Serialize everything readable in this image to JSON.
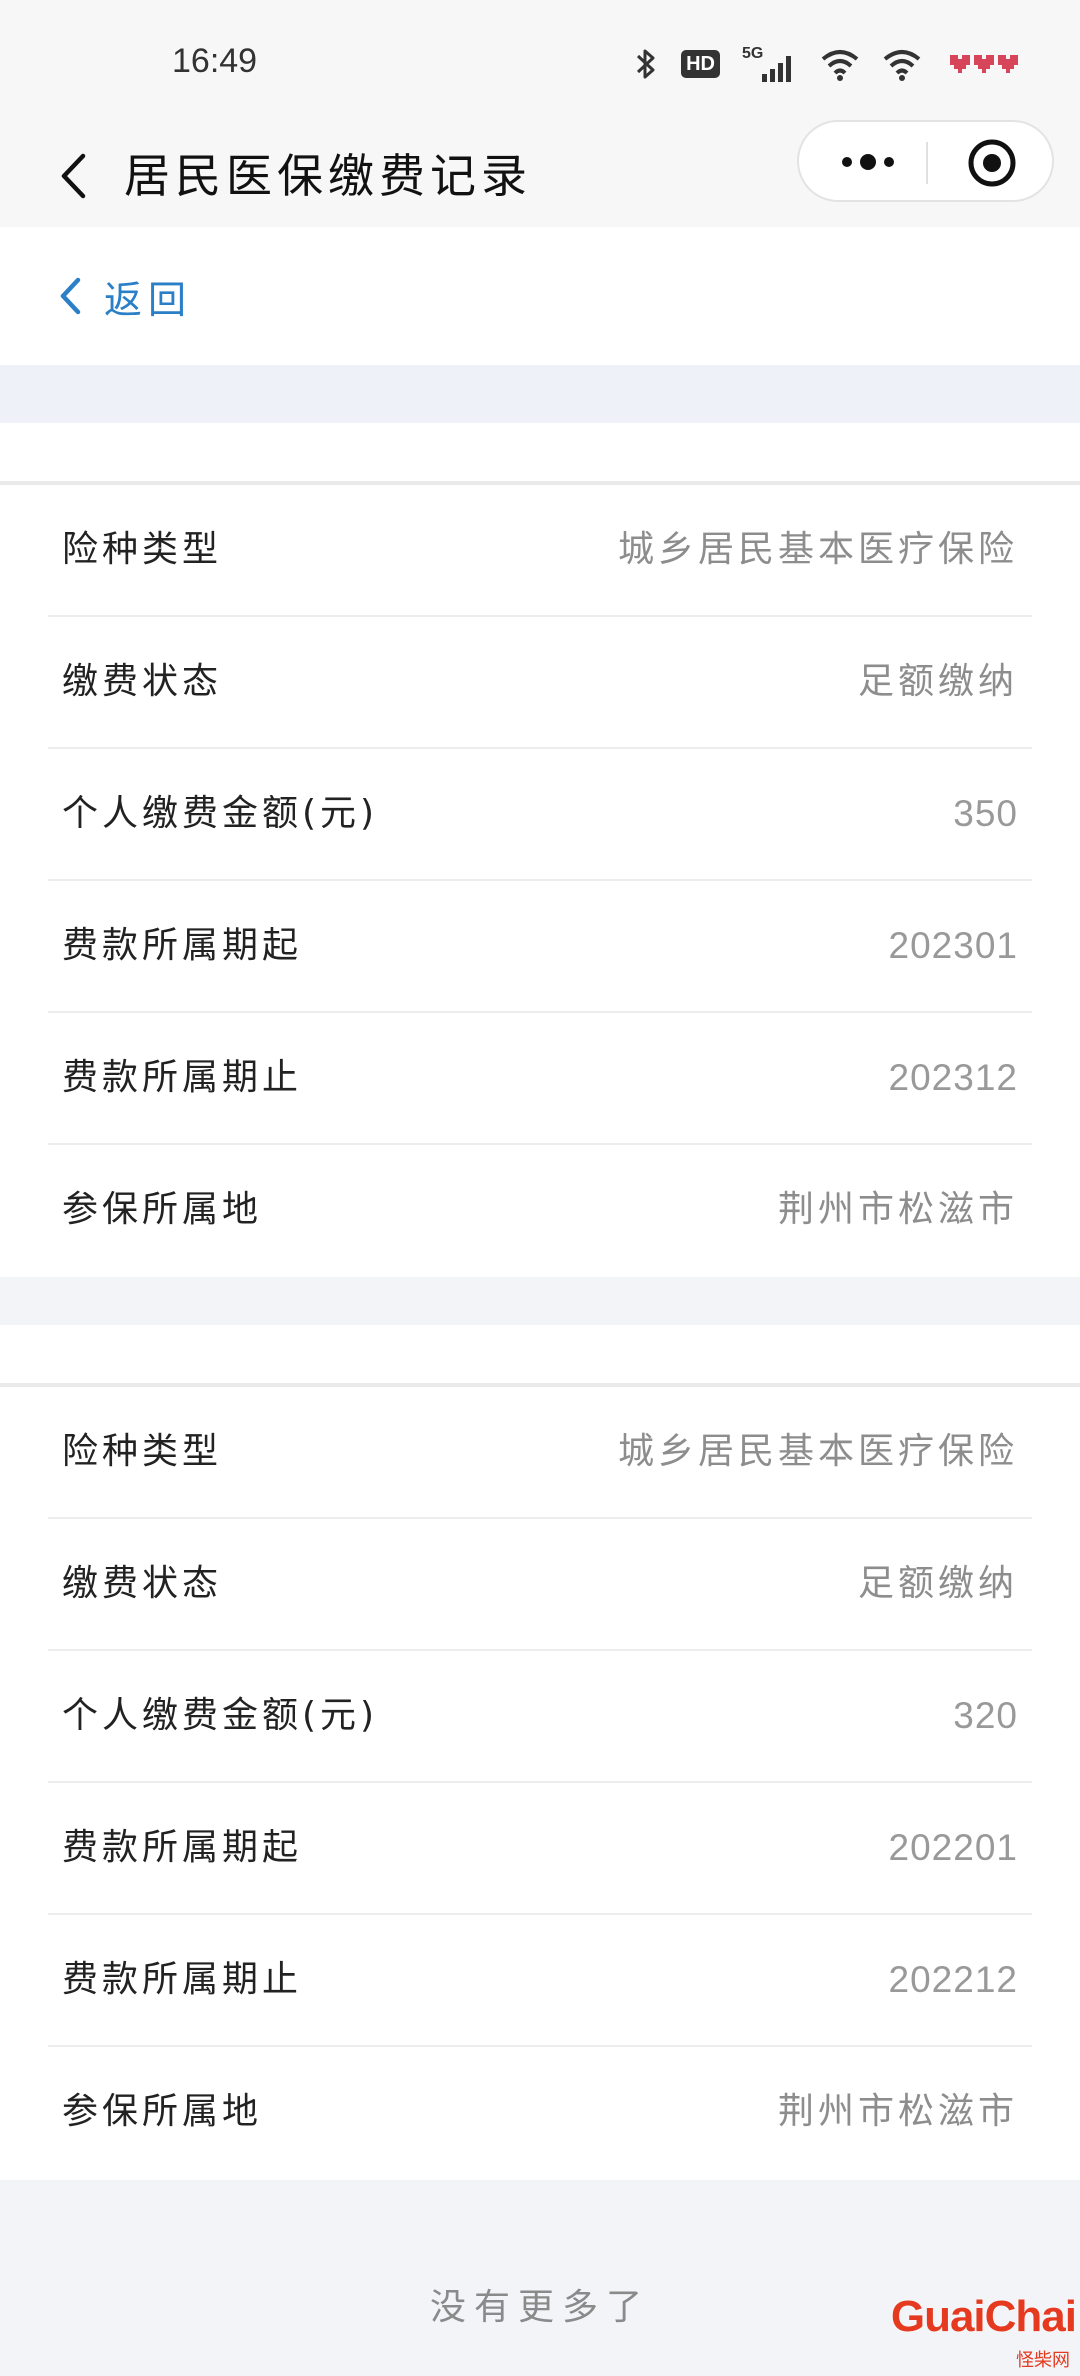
{
  "status_bar": {
    "time": "16:49",
    "hd_badge": "HD",
    "network": "5G",
    "icons": [
      "bluetooth-icon",
      "hd-icon",
      "signal-5g-icon",
      "wifi-icon",
      "wifi-icon",
      "battery-icon"
    ]
  },
  "nav": {
    "title": "居民医保缴费记录",
    "back_icon": "chevron-left-icon",
    "more_icon": "more-dots-icon",
    "close_icon": "target-circle-icon"
  },
  "back_row": {
    "label": "返回",
    "color": "#2a7fc6"
  },
  "records": [
    {
      "rows": [
        {
          "label": "险种类型",
          "value": "城乡居民基本医疗保险"
        },
        {
          "label": "缴费状态",
          "value": "足额缴纳"
        },
        {
          "label": "个人缴费金额(元)",
          "value": "350"
        },
        {
          "label": "费款所属期起",
          "value": "202301"
        },
        {
          "label": "费款所属期止",
          "value": "202312"
        },
        {
          "label": "参保所属地",
          "value": "荆州市松滋市"
        }
      ]
    },
    {
      "rows": [
        {
          "label": "险种类型",
          "value": "城乡居民基本医疗保险"
        },
        {
          "label": "缴费状态",
          "value": "足额缴纳"
        },
        {
          "label": "个人缴费金额(元)",
          "value": "320"
        },
        {
          "label": "费款所属期起",
          "value": "202201"
        },
        {
          "label": "费款所属期止",
          "value": "202212"
        },
        {
          "label": "参保所属地",
          "value": "荆州市松滋市"
        }
      ]
    }
  ],
  "footer": {
    "text": "没有更多了"
  },
  "watermark": {
    "brand": "GuaiChai",
    "brand_cn": "怪柴网"
  },
  "colors": {
    "accent": "#2a7fc6",
    "value_text": "#8d8d8d",
    "background": "#f3f4f8",
    "watermark": "#e53a1f"
  }
}
